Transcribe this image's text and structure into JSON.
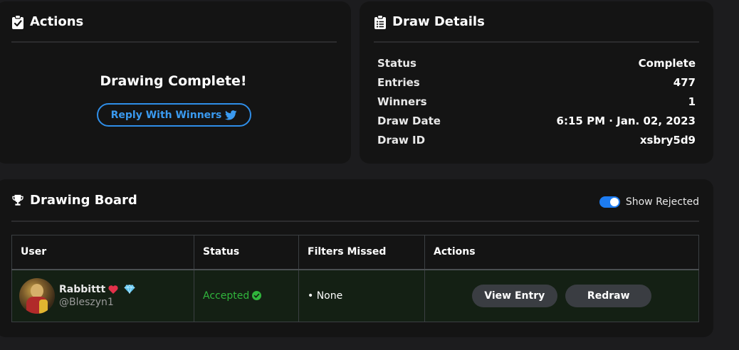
{
  "actions_card": {
    "title": "Actions",
    "message": "Drawing Complete!",
    "reply_label": "Reply With Winners"
  },
  "details_card": {
    "title": "Draw Details",
    "rows": [
      {
        "label": "Status",
        "value": "Complete"
      },
      {
        "label": "Entries",
        "value": "477"
      },
      {
        "label": "Winners",
        "value": "1"
      },
      {
        "label": "Draw Date",
        "value": "6:15 PM · Jan. 02, 2023"
      },
      {
        "label": "Draw ID",
        "value": "xsbry5d9"
      }
    ]
  },
  "board_card": {
    "title": "Drawing Board",
    "show_rejected_label": "Show Rejected",
    "show_rejected_on": true,
    "columns": [
      "User",
      "Status",
      "Filters Missed",
      "Actions"
    ],
    "rows": [
      {
        "name": "Rabbittt",
        "handle": "@Bleszyn1",
        "status": "Accepted",
        "filters_missed": "• None",
        "view_label": "View Entry",
        "redraw_label": "Redraw"
      }
    ]
  },
  "icons": {
    "actions": "clipboard-check-icon",
    "details": "clipboard-list-icon",
    "board": "trophy-icon",
    "reply": "twitter-icon",
    "status": "check-circle-icon",
    "badges": [
      "heart-icon",
      "diamond-icon"
    ]
  },
  "colors": {
    "accent_blue": "#2f8ee8",
    "accepted_green": "#30b53c",
    "row_background": "#142014",
    "card_background": "#141414"
  }
}
